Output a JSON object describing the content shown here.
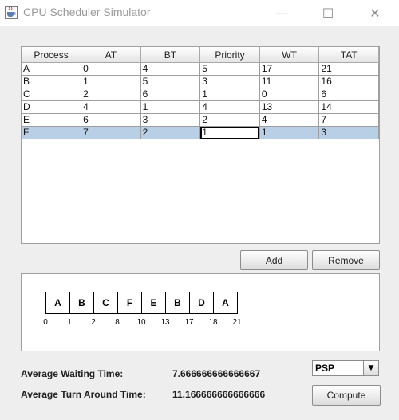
{
  "window": {
    "title": "CPU Scheduler Simulator",
    "minimize_glyph": "—",
    "maximize_glyph": "☐",
    "close_glyph": "✕"
  },
  "table": {
    "columns": [
      "Process",
      "AT",
      "BT",
      "Priority",
      "WT",
      "TAT"
    ],
    "rows": [
      [
        "A",
        "0",
        "4",
        "5",
        "17",
        "21"
      ],
      [
        "B",
        "1",
        "5",
        "3",
        "11",
        "16"
      ],
      [
        "C",
        "2",
        "6",
        "1",
        "0",
        "6"
      ],
      [
        "D",
        "4",
        "1",
        "4",
        "13",
        "14"
      ],
      [
        "E",
        "6",
        "3",
        "2",
        "4",
        "7"
      ],
      [
        "F",
        "7",
        "2",
        "1",
        "1",
        "3"
      ]
    ],
    "selected_row": 5,
    "editing_cell": [
      5,
      3
    ]
  },
  "buttons": {
    "add": "Add",
    "remove": "Remove",
    "compute": "Compute"
  },
  "gantt": {
    "blocks": [
      "A",
      "B",
      "C",
      "F",
      "E",
      "B",
      "D",
      "A"
    ],
    "ticks": [
      "0",
      "1",
      "2",
      "8",
      "10",
      "13",
      "17",
      "18",
      "21"
    ]
  },
  "stats": {
    "avg_wt_label": "Average Waiting Time:",
    "avg_wt_value": "7.666666666666667",
    "avg_tat_label": "Average Turn Around Time:",
    "avg_tat_value": "11.166666666666666"
  },
  "algorithm": {
    "selected": "PSP"
  },
  "colors": {
    "selected_row": "#b8cfe5",
    "client_bg": "#eeeeee"
  }
}
